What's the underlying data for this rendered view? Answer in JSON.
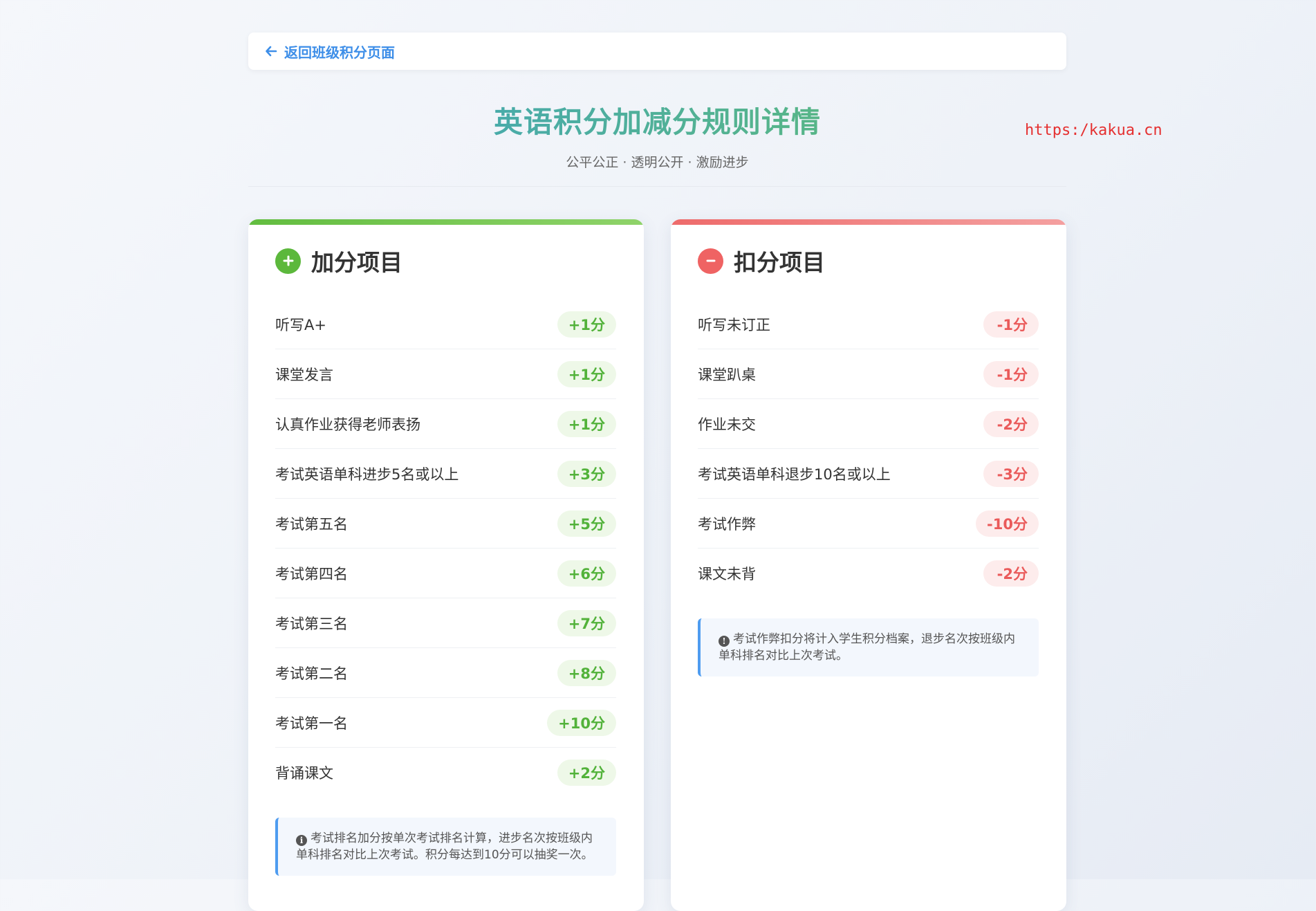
{
  "nav": {
    "back_label": "返回班级积分页面"
  },
  "header": {
    "title": "英语积分加减分规则详情",
    "subtitle": "公平公正 · 透明公开 · 激励进步"
  },
  "watermark": "https:/kakua.cn",
  "plus_card": {
    "title": "加分项目",
    "icon": "plus-circle-icon",
    "accent": "#5cb83c",
    "rules": [
      {
        "name": "听写A+",
        "points": "+1分"
      },
      {
        "name": "课堂发言",
        "points": "+1分"
      },
      {
        "name": "认真作业获得老师表扬",
        "points": "+1分"
      },
      {
        "name": "考试英语单科进步5名或以上",
        "points": "+3分"
      },
      {
        "name": "考试第五名",
        "points": "+5分"
      },
      {
        "name": "考试第四名",
        "points": "+6分"
      },
      {
        "name": "考试第三名",
        "points": "+7分"
      },
      {
        "name": "考试第二名",
        "points": "+8分"
      },
      {
        "name": "考试第一名",
        "points": "+10分"
      },
      {
        "name": "背诵课文",
        "points": "+2分"
      }
    ],
    "note": "考试排名加分按单次考试排名计算，进步名次按班级内单科排名对比上次考试。积分每达到10分可以抽奖一次。"
  },
  "minus_card": {
    "title": "扣分项目",
    "icon": "minus-circle-icon",
    "accent": "#ef6363",
    "rules": [
      {
        "name": "听写未订正",
        "points": "-1分"
      },
      {
        "name": "课堂趴桌",
        "points": "-1分"
      },
      {
        "name": "作业未交",
        "points": "-2分"
      },
      {
        "name": "考试英语单科退步10名或以上",
        "points": "-3分"
      },
      {
        "name": "考试作弊",
        "points": "-10分"
      },
      {
        "name": "课文未背",
        "points": "-2分"
      }
    ],
    "note": "考试作弊扣分将计入学生积分档案，退步名次按班级内单科排名对比上次考试。"
  }
}
